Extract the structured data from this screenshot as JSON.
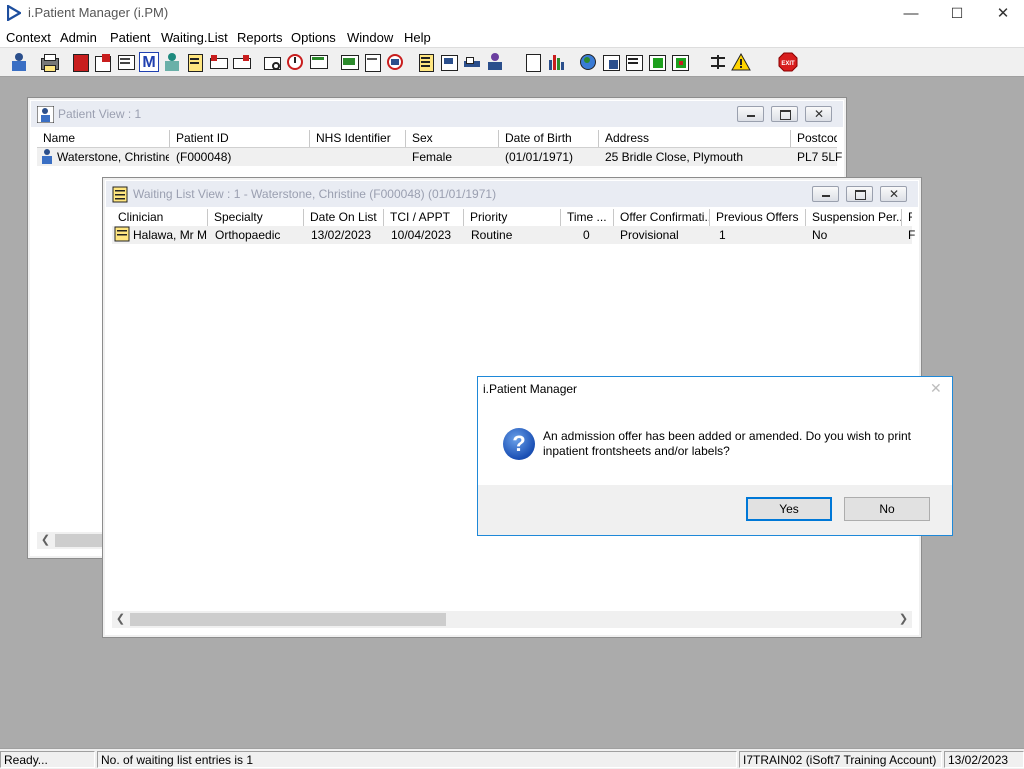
{
  "app": {
    "title": "i.Patient Manager (i.PM)"
  },
  "window_controls": {
    "minimize": "—",
    "maximize": "☐",
    "close": "✕"
  },
  "menu": [
    "Context",
    "Admin",
    "Patient",
    "Waiting.List",
    "Reports",
    "Options",
    "Window",
    "Help"
  ],
  "toolbar": {
    "icons": [
      "patient-search-icon",
      "printer-icon",
      "book-icon",
      "edit-form-icon",
      "card-index-icon",
      "letter-m-icon",
      "clinician-icon",
      "notes-icon",
      "referral-icon",
      "transfer-icon",
      "envelope-icon",
      "clock-icon",
      "monitor-icon",
      "screen-icon",
      "document-icon",
      "schedule-icon",
      "list-icon",
      "ward-icon",
      "bed-icon",
      "admit-icon",
      "page-icon",
      "bar-chart-icon",
      "globe-icon",
      "check-form-icon",
      "check-list-icon",
      "green-approve-icon",
      "green-reject-icon",
      "switch-icon",
      "warning-icon",
      "exit-icon"
    ],
    "exit_label": "EXIT"
  },
  "patient_view": {
    "title": "Patient View : 1",
    "columns": [
      "Name",
      "Patient ID",
      "NHS Identifier",
      "Sex",
      "Date of Birth",
      "Address",
      "Postcod"
    ],
    "rows": [
      {
        "name": "Waterstone, Christine...",
        "patient_id": "(F000048)",
        "nhs_identifier": "",
        "sex": "Female",
        "dob": "(01/01/1971)",
        "address": "25 Bridle Close, Plymouth",
        "postcode": "PL7 5LF"
      }
    ]
  },
  "waiting_list_view": {
    "title": "Waiting List View :  1 - Waterstone, Christine (F000048) (01/01/1971)",
    "columns": [
      "Clinician",
      "Specialty",
      "Date On List",
      "TCI / APPT",
      "Priority",
      "Time ...",
      "Offer Confirmati...",
      "Previous Offers",
      "Suspension Per...",
      "R"
    ],
    "rows": [
      {
        "clinician": "Halawa, Mr M",
        "specialty": "Orthopaedic",
        "date_on_list": "13/02/2023",
        "tci_appt": "10/04/2023",
        "priority": "Routine",
        "time": "0",
        "offer_confirmation": "Provisional",
        "previous_offers": "1",
        "suspension_period": "No",
        "r": "F"
      }
    ]
  },
  "dialog": {
    "title": "i.Patient Manager",
    "message": "An admission offer has been added or amended. Do you wish to print inpatient frontsheets and/or labels?",
    "yes_label": "Yes",
    "no_label": "No",
    "close_glyph": "✕",
    "icon_glyph": "?"
  },
  "status_bar": {
    "ready": "Ready...",
    "entries": "No. of waiting list entries is 1",
    "account": "I7TRAIN02 (iSoft7 Training Account)",
    "date": "13/02/2023"
  }
}
